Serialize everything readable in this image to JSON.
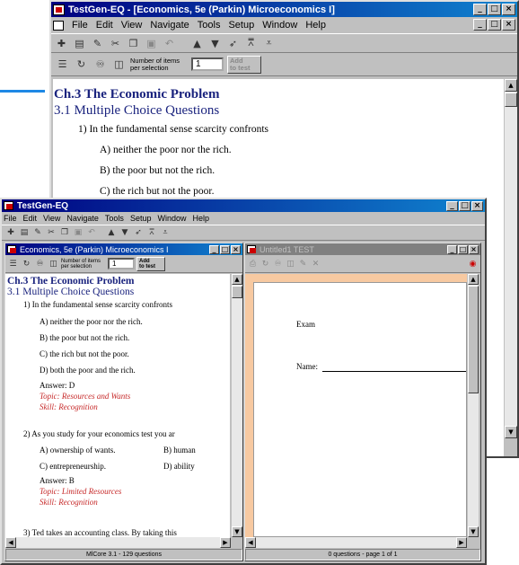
{
  "accent_line_color": "#1e88e5",
  "back_window": {
    "title": "TestGen-EQ - [Economics, 5e (Parkin) Microeconomics I]",
    "window_buttons": [
      "_",
      "□",
      "×"
    ],
    "doc_buttons": [
      "_",
      "□",
      "×"
    ],
    "menu": [
      "File",
      "Edit",
      "View",
      "Navigate",
      "Tools",
      "Setup",
      "Window",
      "Help"
    ],
    "toolbar_icons": [
      "new-icon",
      "open-icon",
      "edit-icon",
      "cut-icon",
      "copy-icon",
      "paste-icon",
      "undo-icon",
      "up-arrow-icon",
      "down-arrow-icon",
      "pin-icon",
      "sort-up-icon",
      "sort-down-icon"
    ],
    "selection": {
      "label_line1": "Number of items",
      "label_line2": "per selection",
      "value": "1",
      "add_line1": "Add",
      "add_line2": "to test"
    },
    "doc": {
      "chapter": "Ch.3 The Economic Problem",
      "section": "3.1 Multiple Choice Questions",
      "question": "1)  In the fundamental sense scarcity confronts",
      "options": [
        "A) neither the poor nor the rich.",
        "B) the poor but not the rich.",
        "C) the rich but not the poor."
      ]
    }
  },
  "front_window": {
    "title": "TestGen-EQ",
    "window_buttons": [
      "_",
      "□",
      "×"
    ],
    "menu": [
      "File",
      "Edit",
      "View",
      "Navigate",
      "Tools",
      "Setup",
      "Window",
      "Help"
    ],
    "toolbar_icons": [
      "new-icon",
      "open-icon",
      "edit-icon",
      "cut-icon",
      "copy-icon",
      "paste-icon",
      "undo-icon",
      "up-arrow-icon",
      "down-arrow-icon",
      "pin-icon",
      "sort-up-icon",
      "sort-down-icon"
    ],
    "left_pane": {
      "title": "Economics, 5e (Parkin) Microeconomics I",
      "selection": {
        "label_line1": "Number of items",
        "label_line2": "per selection",
        "value": "1",
        "add_line1": "Add",
        "add_line2": "to test"
      },
      "chapter": "Ch.3 The Economic Problem",
      "section": "3.1 Multiple Choice Questions",
      "q1": {
        "text": "1)  In the fundamental sense scarcity confronts",
        "options": [
          "A) neither the poor nor the rich.",
          "B) the poor but not the rich.",
          "C) the rich but not the poor.",
          "D) both the poor and the rich."
        ],
        "answer": "Answer: D",
        "topic": "Topic: Resources and Wants",
        "skill": "Skill: Recognition"
      },
      "q2": {
        "text": "2)  As you study for your economics test you ar",
        "options_left": [
          "A) ownership of wants.",
          "C) entrepreneurship."
        ],
        "options_right": [
          "B) human",
          "D) ability"
        ],
        "answer": "Answer: B",
        "topic": "Topic: Limited Resources",
        "skill": "Skill: Recognition"
      },
      "q3": {
        "text": "3)  Ted takes an accounting class. By taking this"
      },
      "status": "MlCore 3.1 - 129 questions"
    },
    "right_pane": {
      "title": "Untitled1 TEST",
      "exam_label": "Exam",
      "name_label": "Name:",
      "status": "0 questions - page 1 of 1",
      "page_bg": "#f7c9a1"
    }
  }
}
